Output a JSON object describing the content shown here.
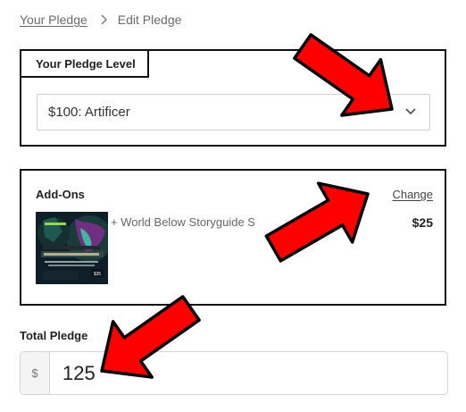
{
  "breadcrumb": {
    "parent": "Your Pledge",
    "current": "Edit Pledge"
  },
  "pledge_level": {
    "label": "Your Pledge Level",
    "selected": "$100: Artificer"
  },
  "addons": {
    "title": "Add-Ons",
    "change_label": "Change",
    "items": [
      {
        "name": "+ World Below Storyguide S",
        "price": "$25",
        "thumbnail_price": "$35"
      }
    ]
  },
  "total": {
    "label": "Total Pledge",
    "currency": "$",
    "value": "125"
  },
  "colors": {
    "arrow": "#ff0000",
    "arrow_outline": "#000000",
    "border": "#111111"
  },
  "icons": {
    "breadcrumb_separator": "chevron-right-icon",
    "select_toggle": "chevron-down-icon"
  }
}
